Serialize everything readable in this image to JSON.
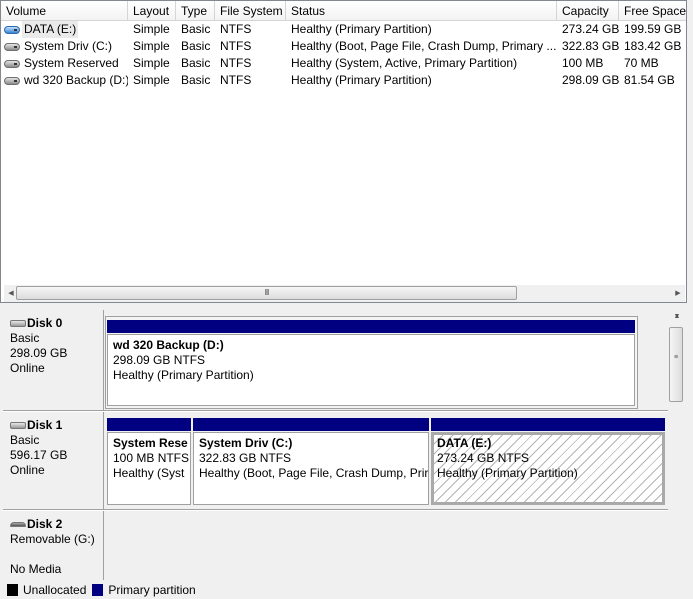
{
  "list": {
    "columns": [
      "Volume",
      "Layout",
      "Type",
      "File System",
      "Status",
      "Capacity",
      "Free Space"
    ],
    "rows": [
      {
        "volume": "DATA (E:)",
        "icon": "blue-drive-icon",
        "selected": true,
        "layout": "Simple",
        "type": "Basic",
        "fs": "NTFS",
        "status": "Healthy (Primary Partition)",
        "capacity": "273.24 GB",
        "free": "199.59 GB"
      },
      {
        "volume": "System Driv (C:)",
        "icon": "drive-icon",
        "layout": "Simple",
        "type": "Basic",
        "fs": "NTFS",
        "status": "Healthy (Boot, Page File, Crash Dump, Primary ...",
        "capacity": "322.83 GB",
        "free": "183.42 GB"
      },
      {
        "volume": "System Reserved",
        "icon": "drive-icon",
        "layout": "Simple",
        "type": "Basic",
        "fs": "NTFS",
        "status": "Healthy (System, Active, Primary Partition)",
        "capacity": "100 MB",
        "free": "70 MB"
      },
      {
        "volume": "wd 320 Backup (D:)",
        "icon": "drive-icon",
        "layout": "Simple",
        "type": "Basic",
        "fs": "NTFS",
        "status": "Healthy (Primary Partition)",
        "capacity": "298.09 GB",
        "free": "81.54 GB"
      }
    ],
    "hscroll_grip": "III"
  },
  "disks": [
    {
      "name": "Disk 0",
      "line1": "Basic",
      "line2": "298.09 GB",
      "line3": "Online",
      "partitions": [
        {
          "name": "wd 320 Backup  (D:)",
          "size": "298.09 GB NTFS",
          "status": "Healthy (Primary Partition)"
        }
      ]
    },
    {
      "name": "Disk 1",
      "line1": "Basic",
      "line2": "596.17 GB",
      "line3": "Online",
      "partitions": [
        {
          "name": "System Rese",
          "size": "100 MB NTFS",
          "status": "Healthy (Syst"
        },
        {
          "name": "System Driv  (C:)",
          "size": "322.83 GB NTFS",
          "status": "Healthy (Boot, Page File, Crash Dump, Prir"
        },
        {
          "name": "DATA  (E:)",
          "size": "273.24 GB NTFS",
          "status": "Healthy (Primary Partition)",
          "selected": true
        }
      ]
    },
    {
      "name": "Disk 2",
      "line1": "Removable (G:)",
      "line2": "",
      "line3": "No Media",
      "partitions": []
    }
  ],
  "vscroll_grip": "≡",
  "legend": [
    {
      "label": "Unallocated",
      "color": "#000000"
    },
    {
      "label": "Primary partition",
      "color": "#000080"
    }
  ]
}
